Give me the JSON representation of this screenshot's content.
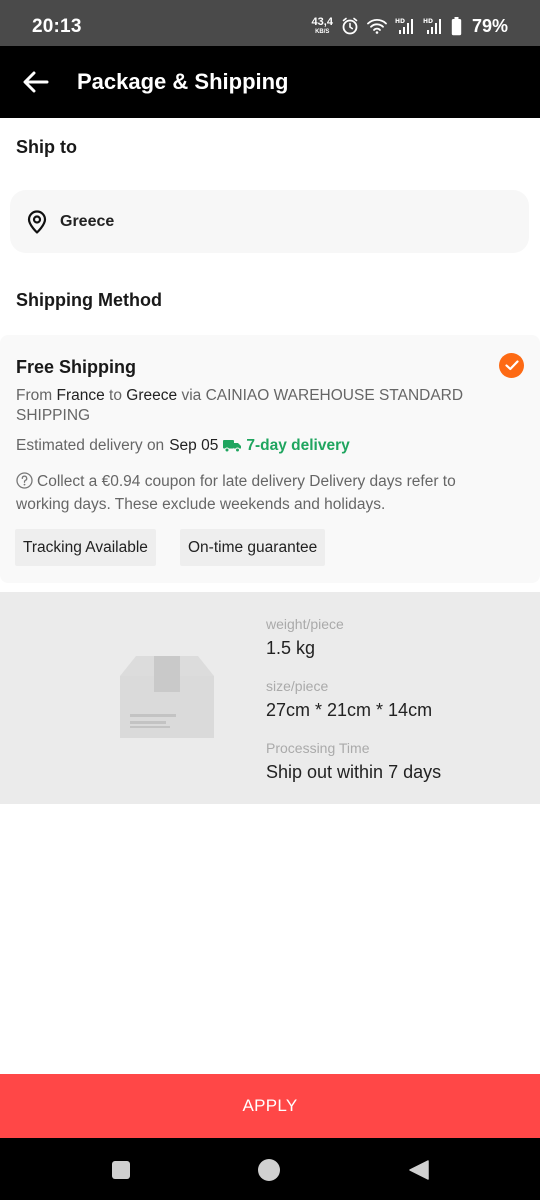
{
  "status_bar": {
    "time": "20:13",
    "net_speed": "43,4",
    "net_unit": "KB/S",
    "battery": "79%",
    "icons": [
      "alarm-icon",
      "wifi-icon",
      "signal-hd-icon",
      "signal-hd-icon",
      "battery-icon"
    ]
  },
  "header": {
    "title": "Package & Shipping",
    "back_icon": "arrow-left-icon"
  },
  "ship_to": {
    "title": "Ship to",
    "location": "Greece",
    "icon": "location-pin-icon"
  },
  "shipping_method": {
    "title": "Shipping Method",
    "option": {
      "name": "Free Shipping",
      "selected": true,
      "route_from_label": "From",
      "from": "France",
      "route_to_label": "to",
      "to": "Greece",
      "via_text": "via CAINIAO WAREHOUSE STANDARD SHIPPING",
      "eta_label": "Estimated delivery on",
      "eta_date": "Sep 05",
      "fast_delivery": "7-day delivery",
      "coupon_note": "Collect a €0.94 coupon for late delivery Delivery days refer to working days. These exclude weekends and holidays.",
      "tags": [
        "Tracking Available",
        "On-time guarantee"
      ]
    }
  },
  "package": {
    "weight_label": "weight/piece",
    "weight_value": "1.5 kg",
    "size_label": "size/piece",
    "size_value": "27cm * 21cm * 14cm",
    "processing_label": "Processing Time",
    "processing_value": "Ship out within 7 days"
  },
  "footer": {
    "apply_label": "APPLY"
  },
  "colors": {
    "accent_orange": "#fd6a14",
    "apply_red": "#ff4747",
    "fast_green": "#1fa55f"
  }
}
